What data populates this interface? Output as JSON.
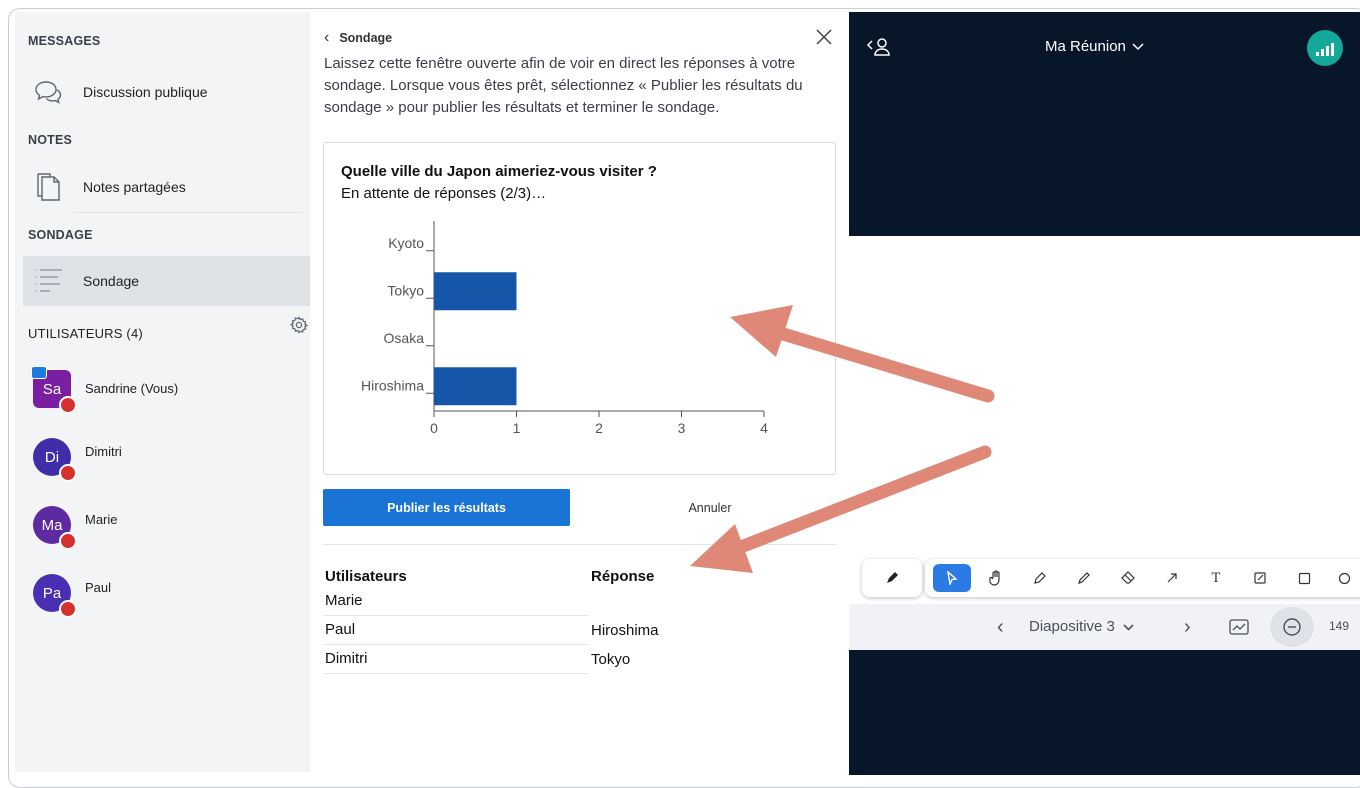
{
  "sidebar": {
    "messages_title": "MESSAGES",
    "public_chat_label": "Discussion publique",
    "notes_title": "NOTES",
    "shared_notes_label": "Notes partagées",
    "poll_title": "SONDAGE",
    "poll_label": "Sondage",
    "users_title": "UTILISATEURS (4)",
    "users": [
      {
        "initials": "Sa",
        "name": "Sandrine (Vous)",
        "color": "#7b1fa2"
      },
      {
        "initials": "Di",
        "name": "Dimitri",
        "color": "#3f2ea8"
      },
      {
        "initials": "Ma",
        "name": "Marie",
        "color": "#5e2aa0"
      },
      {
        "initials": "Pa",
        "name": "Paul",
        "color": "#4a2fb5"
      }
    ]
  },
  "poll": {
    "header_title": "Sondage",
    "description": "Laissez cette fenêtre ouverte afin de voir en direct les réponses à votre sondage. Lorsque vous êtes prêt, sélectionnez « Publier les résultats du sondage » pour publier les résultats et terminer le sondage.",
    "question": "Quelle ville du Japon aimeriez-vous visiter ?",
    "waiting": "En attente de réponses (2/3)…",
    "publish_label": "Publier les résultats",
    "cancel_label": "Annuler",
    "table": {
      "col_users": "Utilisateurs",
      "col_answer": "Réponse",
      "rows": [
        {
          "user": "Marie",
          "answer": ""
        },
        {
          "user": "Paul",
          "answer": "Hiroshima"
        },
        {
          "user": "Dimitri",
          "answer": "Tokyo"
        }
      ]
    }
  },
  "chart_data": {
    "type": "bar",
    "orientation": "horizontal",
    "categories": [
      "Kyoto",
      "Tokyo",
      "Osaka",
      "Hiroshima"
    ],
    "values": [
      0,
      1,
      0,
      1
    ],
    "xlim": [
      0,
      4
    ],
    "xticks": [
      "0",
      "1",
      "2",
      "3",
      "4"
    ],
    "bar_color": "#1556a8"
  },
  "meeting": {
    "title": "Ma Réunion",
    "slide_label": "Diapositive 3",
    "zoom_value": "149",
    "accent": "#2c7be5",
    "connection_color": "#14a89a"
  },
  "toolbar": {
    "tools": [
      "select-tool",
      "hand-tool",
      "draw-tool",
      "pencil-tool",
      "eraser-tool",
      "arrow-tool",
      "text-tool",
      "note-tool",
      "rectangle-tool",
      "ellipse-tool"
    ],
    "text_tool_glyph": "T"
  }
}
